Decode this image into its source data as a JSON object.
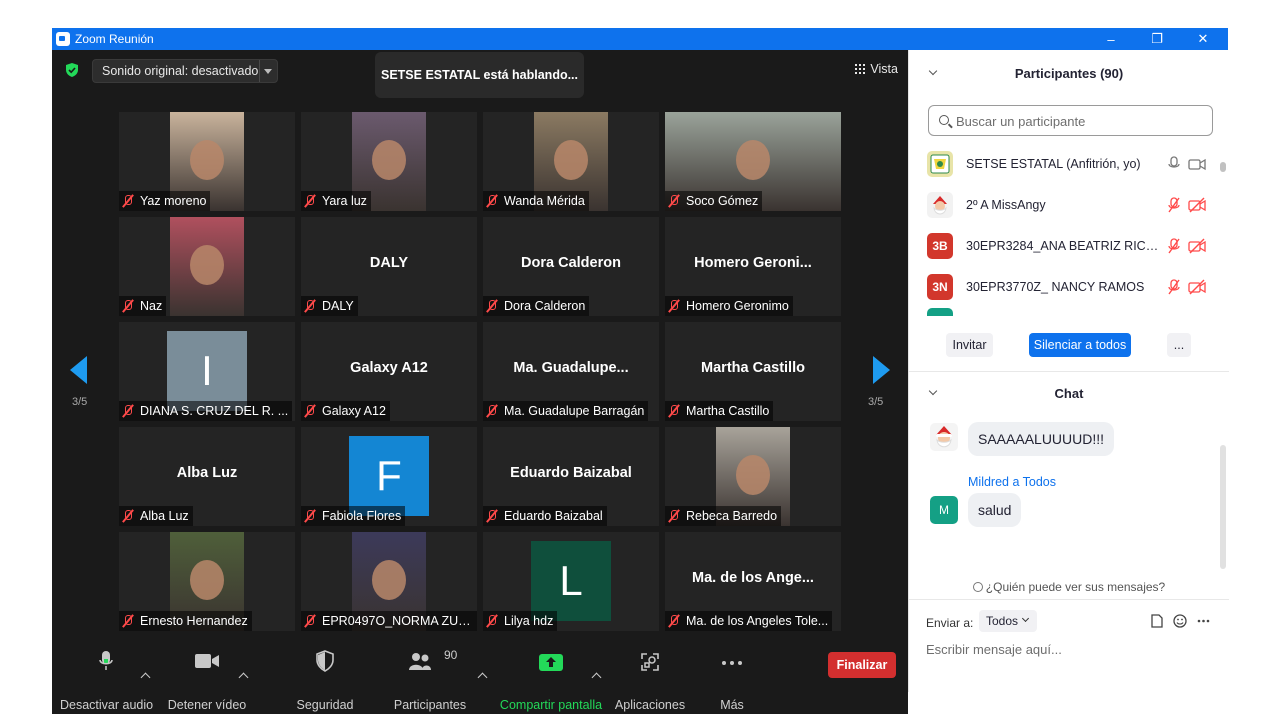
{
  "window": {
    "title": "Zoom Reunión",
    "controls": [
      "–",
      "❐",
      "✕"
    ]
  },
  "meeting": {
    "sound_original": "Sonido original: desactivado",
    "speaking_banner": "SETSE ESTATAL está hablando...",
    "view_label": "Vista",
    "page_left": "3/5",
    "page_right": "3/5"
  },
  "tiles": [
    {
      "name": "Yaz moreno",
      "kind": "photo",
      "photo_color": "#c9b39c"
    },
    {
      "name": "Yara luz",
      "kind": "photo",
      "photo_color": "#6b5a6e"
    },
    {
      "name": "Wanda Mérida",
      "kind": "photo",
      "photo_color": "#8b7a62"
    },
    {
      "name": "Soco Gómez",
      "kind": "photo",
      "photo_color": "#9aa39a"
    },
    {
      "name": "Naz",
      "kind": "photo",
      "photo_color": "#b0505e"
    },
    {
      "name": "DALY",
      "kind": "text",
      "big": "DALY"
    },
    {
      "name": "Dora Calderon",
      "kind": "text",
      "big": "Dora Calderon"
    },
    {
      "name": "Homero Geronimo",
      "kind": "text",
      "big": "Homero  Geroni..."
    },
    {
      "name": "DIANA  S. CRUZ DEL R. ...",
      "kind": "avatar",
      "letter": "I",
      "avatar_color": "#7a8d99"
    },
    {
      "name": "Galaxy A12",
      "kind": "text",
      "big": "Galaxy A12"
    },
    {
      "name": "Ma. Guadalupe Barragán",
      "kind": "text",
      "big": "Ma.  Guadalupe..."
    },
    {
      "name": "Martha Castillo",
      "kind": "text",
      "big": "Martha Castillo"
    },
    {
      "name": "Alba Luz",
      "kind": "text",
      "big": "Alba Luz"
    },
    {
      "name": "Fabiola Flores",
      "kind": "avatar",
      "letter": "F",
      "avatar_color": "#1486d3"
    },
    {
      "name": "Eduardo Baizabal",
      "kind": "text",
      "big": "Eduardo Baizabal"
    },
    {
      "name": "Rebeca Barredo",
      "kind": "photo",
      "photo_color": "#a8a39a"
    },
    {
      "name": "Ernesto Hernandez",
      "kind": "photo",
      "photo_color": "#4f5f3a"
    },
    {
      "name": "EPR0497O_NORMA ZUZ...",
      "kind": "photo",
      "photo_color": "#3c3a5a"
    },
    {
      "name": "Lilya hdz",
      "kind": "avatar",
      "letter": "L",
      "avatar_color": "#0f4f3c"
    },
    {
      "name": "Ma. de los Angeles Tole...",
      "kind": "text",
      "big": "Ma. de los Ange..."
    }
  ],
  "toolbar": {
    "mute": "Desactivar audio",
    "video": "Detener vídeo",
    "security": "Seguridad",
    "participants": "Participantes",
    "participants_count": "90",
    "share": "Compartir pantalla",
    "apps": "Aplicaciones",
    "more": "Más",
    "end": "Finalizar"
  },
  "participants_panel": {
    "title": "Participantes (90)",
    "search_placeholder": "Buscar un participante",
    "items": [
      {
        "name": "SETSE ESTATAL (Anfitrión, yo)",
        "avatar": "",
        "avatar_color": "#e8e4a8",
        "muted": false
      },
      {
        "name": "2º A  MissAngy",
        "avatar": "",
        "avatar_color": "#f2f2f2",
        "muted": true
      },
      {
        "name": "30EPR3284_ANA BEATRIZ RICAR...",
        "avatar": "3B",
        "avatar_color": "#d2372c",
        "muted": true
      },
      {
        "name": "30EPR3770Z_ NANCY RAMOS",
        "avatar": "3N",
        "avatar_color": "#d2372c",
        "muted": true
      }
    ],
    "invite": "Invitar",
    "mute_all": "Silenciar a todos",
    "more": "..."
  },
  "chat": {
    "title": "Chat",
    "messages": [
      {
        "sender": "",
        "text": "SAAAAALUUUUD!!!"
      },
      {
        "sender": "Mildred a Todos",
        "avatar": "M",
        "avatar_color": "#14a085",
        "text": "salud"
      }
    ],
    "who_can_see": "¿Quién puede ver sus mensajes?",
    "send_to_label": "Enviar a:",
    "send_to_value": "Todos",
    "message_placeholder": "Escribir mensaje aquí..."
  },
  "colors": {
    "accent": "#0e72ed",
    "end": "#d32f2f",
    "share": "#23d959",
    "muted": "#ff4a4a"
  }
}
